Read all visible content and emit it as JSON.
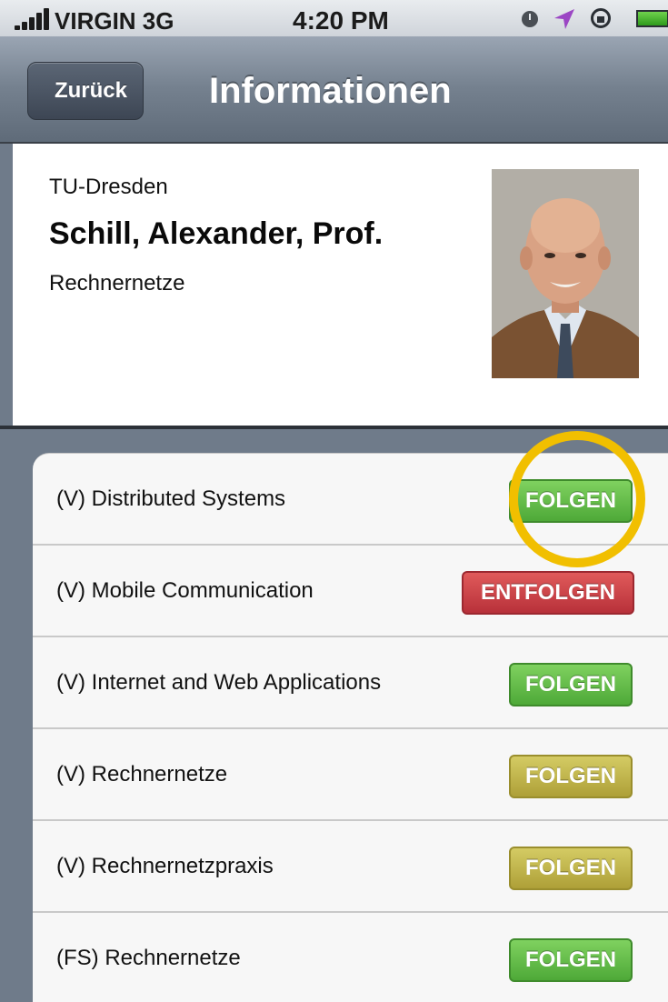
{
  "status_bar": {
    "carrier": "VIRGIN 3G",
    "time": "4:20 PM",
    "icons": [
      "signal-icon",
      "alarm-icon",
      "location-arrow-icon",
      "rotation-lock-icon",
      "battery-icon"
    ]
  },
  "nav": {
    "back_label": "Zurück",
    "title": "Informationen"
  },
  "profile": {
    "institution": "TU-Dresden",
    "name": "Schill, Alexander, Prof.",
    "department": "Rechnernetze"
  },
  "courses": [
    {
      "label": "(V) Distributed Systems",
      "button": "FOLGEN",
      "state": "green"
    },
    {
      "label": "(V) Mobile Communication",
      "button": "ENTFOLGEN",
      "state": "red"
    },
    {
      "label": "(V) Internet and Web Applications",
      "button": "FOLGEN",
      "state": "green"
    },
    {
      "label": "(V) Rechnernetze",
      "button": "FOLGEN",
      "state": "olive"
    },
    {
      "label": "(V) Rechnernetzpraxis",
      "button": "FOLGEN",
      "state": "olive"
    },
    {
      "label": "(FS) Rechnernetze",
      "button": "FOLGEN",
      "state": "green"
    }
  ],
  "colors": {
    "green": "#5cb944",
    "red": "#c9424a",
    "olive": "#c2b84d",
    "highlight": "#f1bf00"
  }
}
